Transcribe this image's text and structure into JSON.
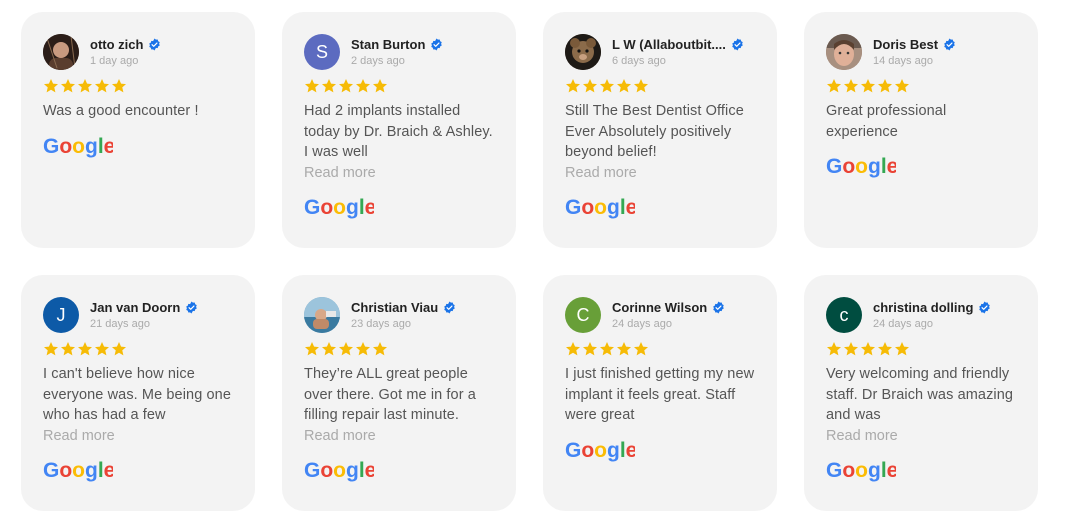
{
  "reviews": [
    {
      "name": "otto zich",
      "date": "1 day ago",
      "text": "Was a good encounter !",
      "read_more": "",
      "avatar_letter": "",
      "avatar_color": "#3b2a22"
    },
    {
      "name": "Stan Burton",
      "date": "2 days ago",
      "text": "Had 2 implants installed today by Dr. Braich & Ashley. I was well",
      "read_more": "Read more",
      "avatar_letter": "S",
      "avatar_color": "#5c6bc0"
    },
    {
      "name": "L W (Allaboutbit....",
      "date": "6 days ago",
      "text": "Still The Best Dentist Office Ever Absolutely positively beyond belief!",
      "read_more": "Read more",
      "avatar_letter": "",
      "avatar_color": "#4a3a2a"
    },
    {
      "name": "Doris Best",
      "date": "14 days ago",
      "text": "Great professional experience",
      "read_more": "",
      "avatar_letter": "",
      "avatar_color": "#8a6a5a"
    },
    {
      "name": "Jan van Doorn",
      "date": "21 days ago",
      "text": "I can't believe how nice everyone was. Me being one who has had a few",
      "read_more": "Read more",
      "avatar_letter": "J",
      "avatar_color": "#0d5aa7"
    },
    {
      "name": "Christian Viau",
      "date": "23 days ago",
      "text": "They’re ALL great people over there. Got me in for a filling repair last minute.",
      "read_more": "Read more",
      "avatar_letter": "",
      "avatar_color": "#6a9ab8"
    },
    {
      "name": "Corinne Wilson",
      "date": "24 days ago",
      "text": "I just finished getting my new implant it feels great. Staff were great",
      "read_more": "",
      "avatar_letter": "C",
      "avatar_color": "#689f38"
    },
    {
      "name": "christina dolling",
      "date": "24 days ago",
      "text": "Very welcoming and friendly staff. Dr Braich was amazing and was",
      "read_more": "Read more",
      "avatar_letter": "c",
      "avatar_color": "#004d40"
    }
  ],
  "rating_stars": 5,
  "colors": {
    "star": "#f6bb06",
    "verified": "#1a73e8",
    "card_bg": "#f3f3f3"
  },
  "icons": {
    "verified": "verified-badge-icon",
    "star": "star-icon",
    "source": "google-logo-icon"
  }
}
